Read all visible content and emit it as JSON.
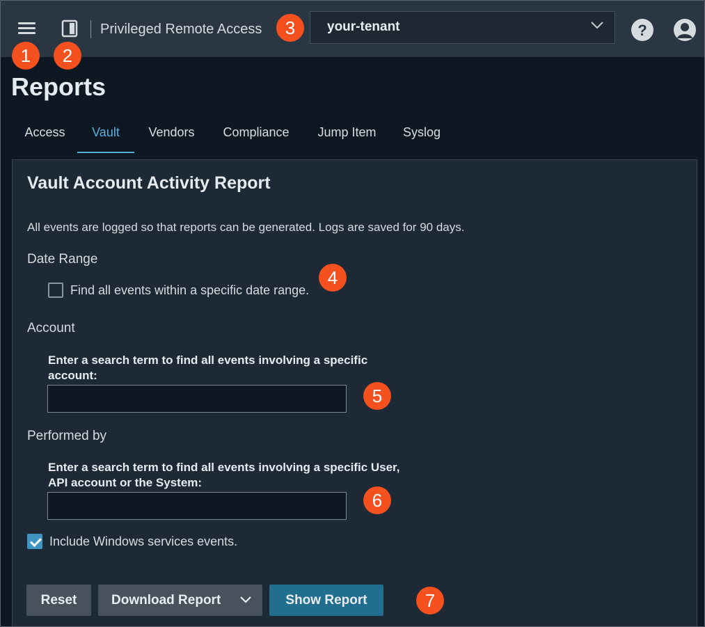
{
  "header": {
    "app_title": "Privileged Remote Access",
    "tenant": {
      "value": "your-tenant"
    },
    "help_label": "?"
  },
  "badges": [
    "1",
    "2",
    "3",
    "4",
    "5",
    "6",
    "7"
  ],
  "page": {
    "title": "Reports"
  },
  "tabs": [
    {
      "label": "Access",
      "active": false
    },
    {
      "label": "Vault",
      "active": true
    },
    {
      "label": "Vendors",
      "active": false
    },
    {
      "label": "Compliance",
      "active": false
    },
    {
      "label": "Jump Item",
      "active": false
    },
    {
      "label": "Syslog",
      "active": false
    }
  ],
  "report": {
    "title": "Vault Account Activity Report",
    "description": "All events are logged so that reports can be generated. Logs are saved for 90 days.",
    "date_range": {
      "heading": "Date Range",
      "checkbox_label": "Find all events within a specific date range.",
      "checked": false
    },
    "account": {
      "heading": "Account",
      "field_label": "Enter a search term to find all events involving a specific account:",
      "value": ""
    },
    "performed_by": {
      "heading": "Performed by",
      "field_label": "Enter a search term to find all events involving a specific User, API account or the System:",
      "value": ""
    },
    "windows_services": {
      "label": "Include Windows services events.",
      "checked": true
    },
    "buttons": {
      "reset": "Reset",
      "download": "Download Report",
      "show": "Show Report"
    }
  },
  "colors": {
    "topbar": "#2b3643",
    "background": "#0e1823",
    "panel": "#1e2936",
    "accent": "#5dafdb",
    "badge": "#f4511e",
    "primary_button": "#226e8f"
  },
  "icons": [
    "hamburger-menu-icon",
    "door-icon",
    "chevron-down-icon",
    "help-icon",
    "user-icon",
    "checkmark-icon"
  ]
}
